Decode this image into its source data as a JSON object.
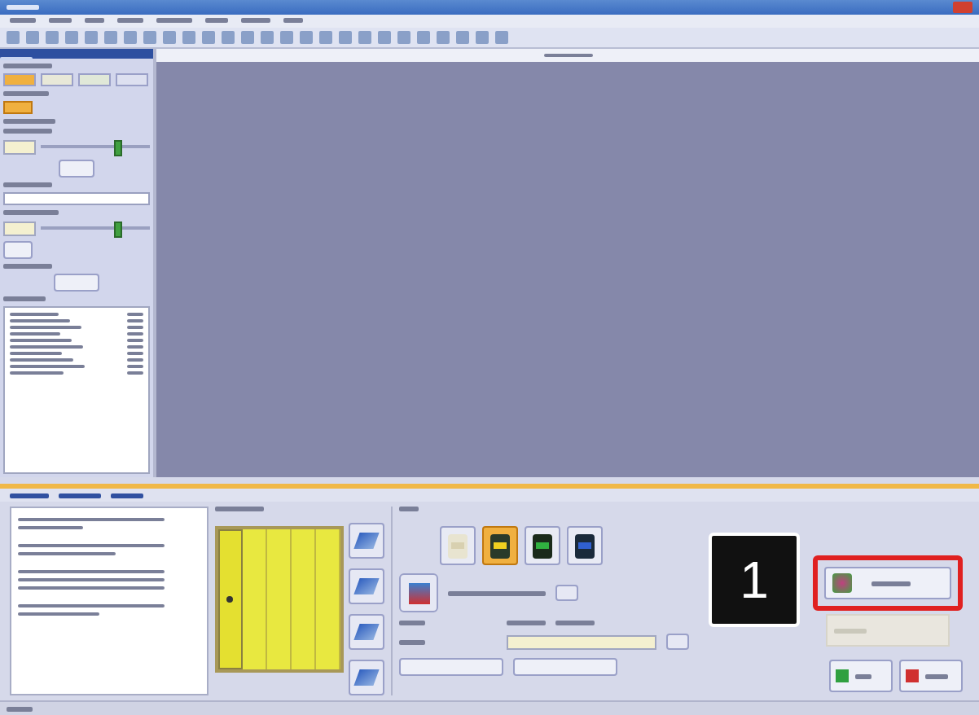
{
  "callout": {
    "number": "1"
  },
  "color_modes": [
    {
      "selected": false
    },
    {
      "selected": true
    },
    {
      "selected": false
    },
    {
      "selected": false
    }
  ],
  "lanes": [
    {
      "selected": true
    },
    {
      "selected": false
    },
    {
      "selected": false
    },
    {
      "selected": false
    },
    {
      "selected": false
    }
  ],
  "primary_action": {
    "highlighted": true
  },
  "sliders": [
    {
      "level": 0.7
    },
    {
      "level": 0.7
    }
  ]
}
